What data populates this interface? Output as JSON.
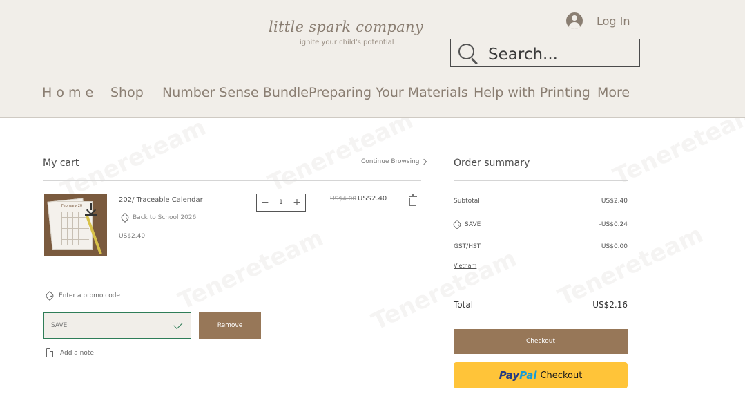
{
  "header": {
    "logo_title": "little spark company",
    "logo_tagline": "ignite your child's potential",
    "login_label": "Log In",
    "search_placeholder": "Search...",
    "nav": [
      "H o m e",
      "Shop",
      "Number Sense Bundle",
      "Preparing Your Materials",
      "Help with Printing",
      "More"
    ]
  },
  "cart": {
    "title": "My cart",
    "continue_label": "Continue Browsing",
    "item": {
      "thumb_label": "February 20",
      "name": "202/ Traceable Calendar",
      "discount_label": "Back to School 2026",
      "unit_price": "US$2.40",
      "quantity": "1",
      "price_original": "US$4.00",
      "price_current": "US$2.40"
    },
    "promo_link": "Enter a promo code",
    "promo_value": "SAVE",
    "remove_label": "Remove",
    "note_link": "Add a note"
  },
  "summary": {
    "title": "Order summary",
    "subtotal_label": "Subtotal",
    "subtotal_value": "US$2.40",
    "save_label": "SAVE",
    "save_value": "-US$0.24",
    "tax_label": "GST/HST",
    "tax_value": "US$0.00",
    "region": "Vietnam",
    "total_label": "Total",
    "total_value": "US$2.16",
    "checkout_label": "Checkout",
    "paypal_pay": "Pay",
    "paypal_pal": "Pal",
    "paypal_label": "Checkout"
  },
  "watermark": "Tenereteam"
}
